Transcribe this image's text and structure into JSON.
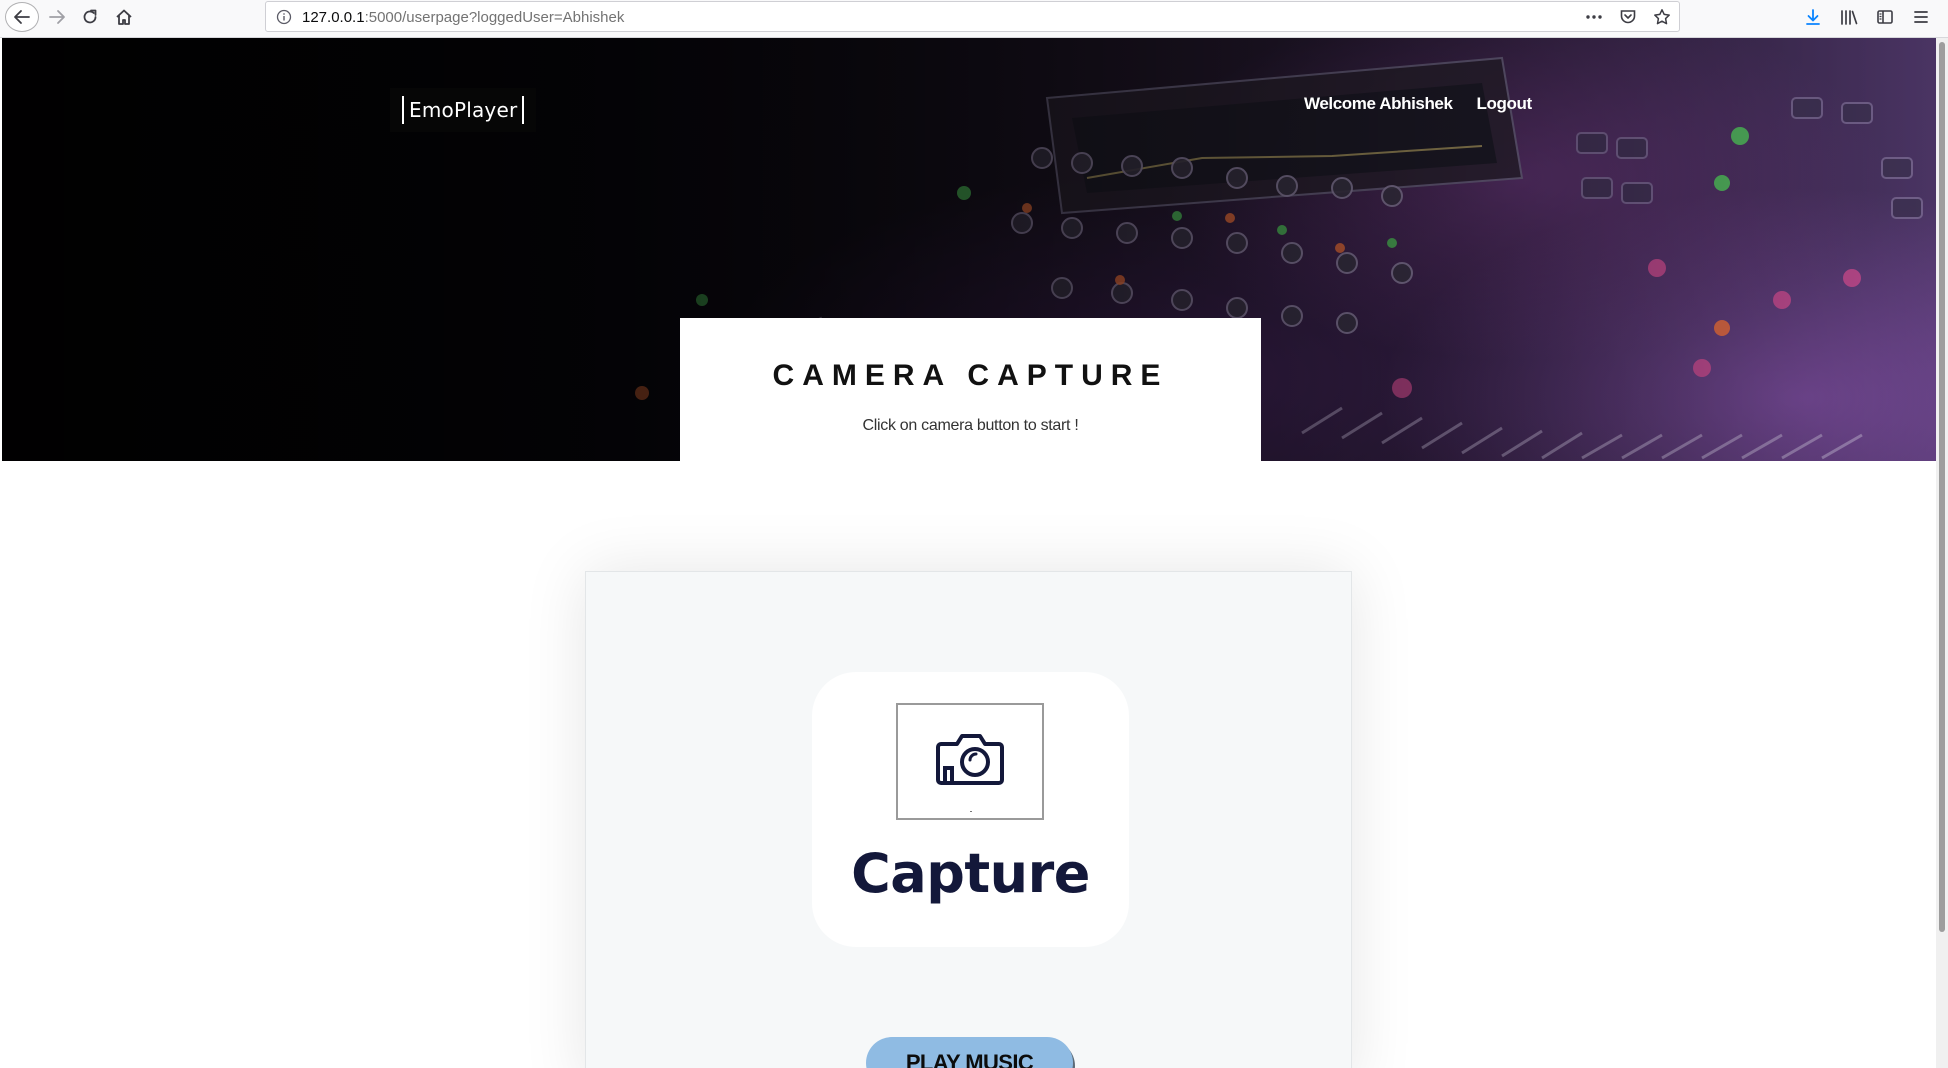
{
  "browser": {
    "url_host": "127.0.0.1",
    "url_path": ":5000/userpage?loggedUser=Abhishek",
    "toolbar_icons": [
      "back-icon",
      "forward-icon",
      "reload-icon",
      "home-icon",
      "page-info-icon",
      "more-actions-icon",
      "pocket-icon",
      "bookmark-star-icon",
      "download-icon",
      "library-icon",
      "sidebar-icon",
      "menu-icon"
    ]
  },
  "header": {
    "brand": "EmoPlayer",
    "nav": {
      "welcome": "Welcome Abhishek",
      "logout": "Logout"
    }
  },
  "hero": {
    "title": "CAMERA CAPTURE",
    "subtitle": "Click on camera button to start !"
  },
  "capture": {
    "label": "Capture",
    "icon": "camera-icon",
    "color": "#13183a"
  },
  "play_button": {
    "label": "PLAY MUSIC",
    "color": "#8fbbe3"
  }
}
